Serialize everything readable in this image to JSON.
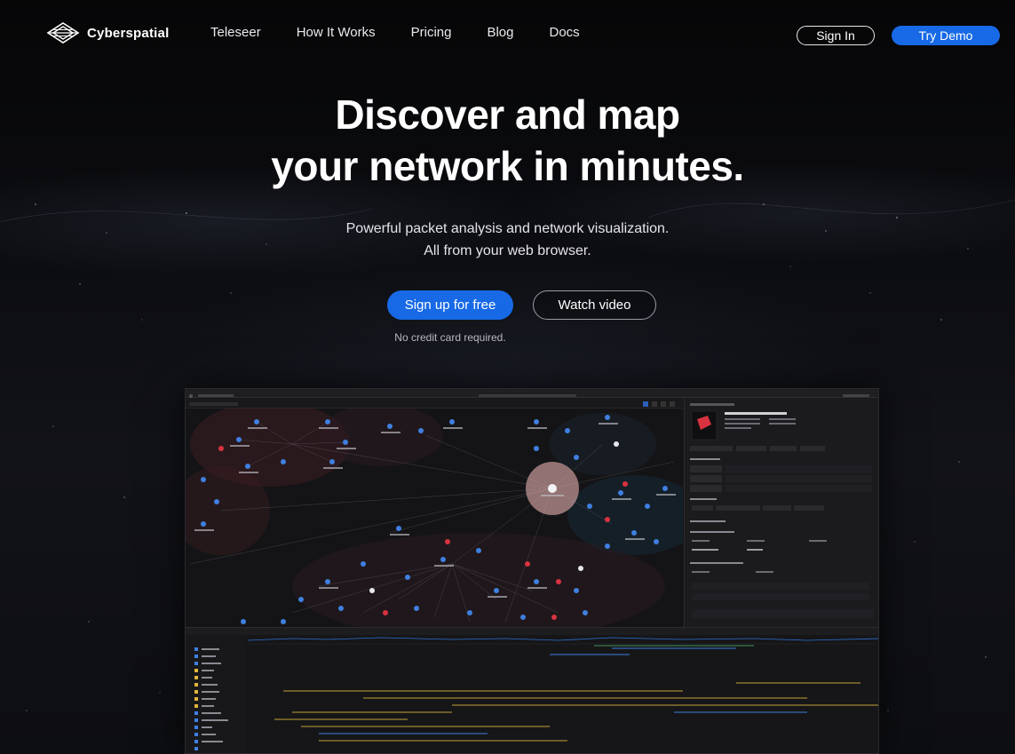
{
  "brand": {
    "name": "Cyberspatial",
    "logo_icon": "layered-diamond-logo"
  },
  "nav": {
    "links": [
      {
        "label": "Teleseer"
      },
      {
        "label": "How It Works"
      },
      {
        "label": "Pricing"
      },
      {
        "label": "Blog"
      },
      {
        "label": "Docs"
      }
    ],
    "sign_in_label": "Sign In",
    "try_demo_label": "Try Demo"
  },
  "hero": {
    "title_line1": "Discover and map",
    "title_line2": "your network in minutes.",
    "subtitle_line1": "Powerful packet analysis and network visualization.",
    "subtitle_line2": "All from your web browser.",
    "primary_cta": "Sign up for free",
    "secondary_cta": "Watch video",
    "note": "No credit card required."
  },
  "colors": {
    "accent": "#1769e6",
    "background": "#0a0a0c",
    "node_blue": "#3f7fe0",
    "node_red": "#d8333f",
    "hub_pink": "#e6b0b0"
  }
}
